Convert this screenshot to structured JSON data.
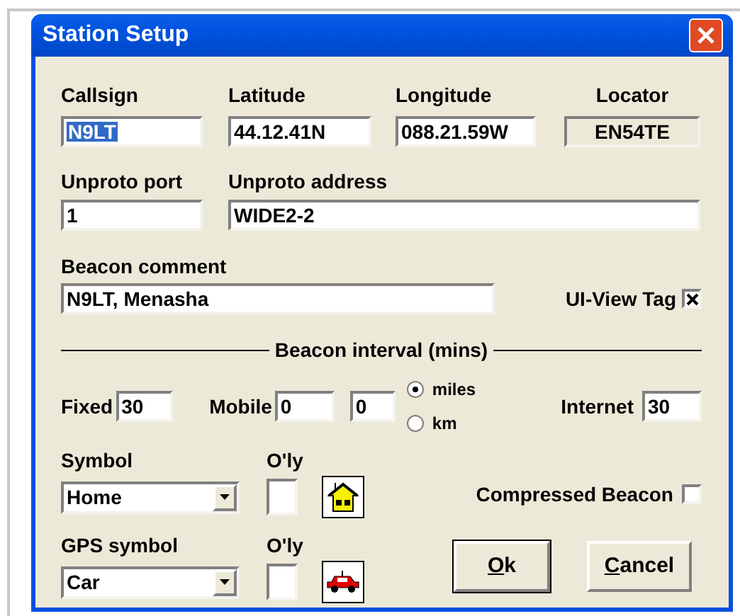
{
  "window": {
    "title": "Station Setup"
  },
  "row_1": [
    {
      "label": "Callsign",
      "value": "N9LT",
      "selected": true,
      "readonly": false
    },
    {
      "label": "Latitude",
      "value": "44.12.41N",
      "selected": false,
      "readonly": false
    },
    {
      "label": "Longitude",
      "value": "088.21.59W",
      "selected": false,
      "readonly": false
    },
    {
      "label": "Locator",
      "value": "EN54TE",
      "selected": false,
      "readonly": true
    }
  ],
  "unproto_port": {
    "label": "Unproto port",
    "value": "1"
  },
  "unproto_address": {
    "label": "Unproto address",
    "value": "WIDE2-2"
  },
  "beacon_comment": {
    "label": "Beacon comment",
    "value": "N9LT, Menasha"
  },
  "ui_view_tag": {
    "label": "UI-View Tag",
    "checked": true
  },
  "beacon_interval": {
    "title": "Beacon interval (mins)",
    "fixed_label": "Fixed",
    "fixed": "30",
    "mobile_label": "Mobile",
    "mobile_1": "0",
    "mobile_2": "0",
    "internet_label": "Internet",
    "internet": "30"
  },
  "units": [
    {
      "label": "miles",
      "selected": true
    },
    {
      "label": "km",
      "selected": false
    }
  ],
  "symbols": [
    {
      "label": "Symbol",
      "value": "Home",
      "overlay_label": "O'ly",
      "overlay_checked": false,
      "kind": "house"
    },
    {
      "label": "GPS symbol",
      "value": "Car",
      "overlay_label": "O'ly",
      "overlay_checked": false,
      "kind": "car"
    }
  ],
  "compressed_beacon": {
    "label": "Compressed Beacon",
    "checked": false
  },
  "buttons": [
    {
      "label": "Ok",
      "default": true
    },
    {
      "label": "Cancel",
      "default": false
    }
  ]
}
